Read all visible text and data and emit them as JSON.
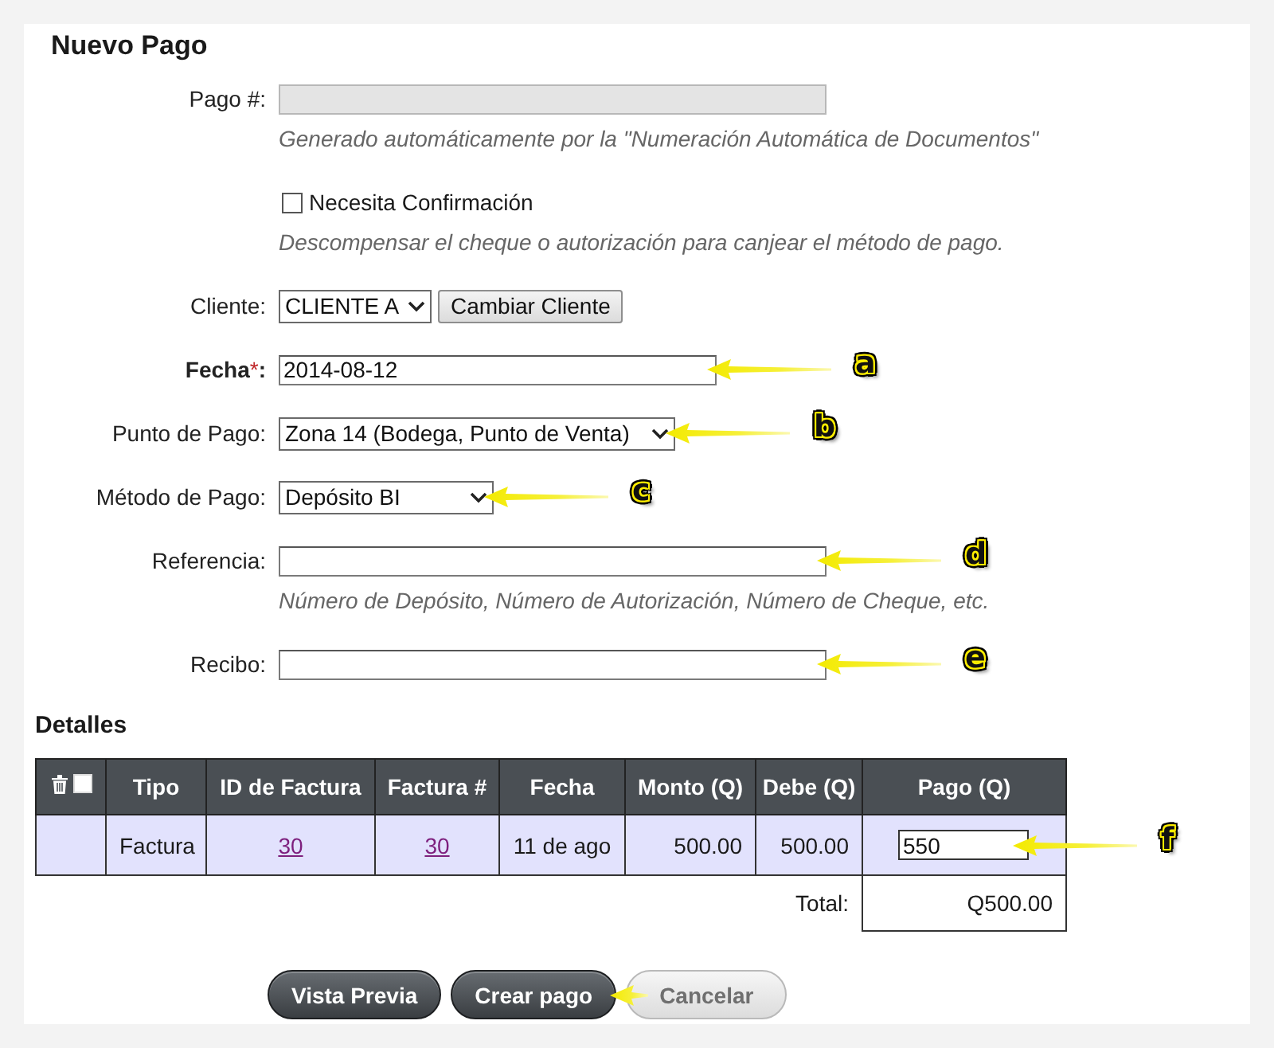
{
  "title": "Nuevo Pago",
  "fields": [
    {
      "kind": "text",
      "label": "Pago #:",
      "disabled": true,
      "hint": "Generado automáticamente por la \"Numeración Automática de Documentos\""
    },
    {
      "kind": "checkbox",
      "text": "Necesita Confirmación",
      "checked": false,
      "hint": "Descompensar el cheque o autorización para canjear el método de pago."
    },
    {
      "kind": "select",
      "label": "Cliente:",
      "value": "CLIENTE A",
      "button": "Cambiar Cliente"
    },
    {
      "kind": "text",
      "label": "Fecha",
      "required_mark": "*",
      "label_end": ":",
      "value": "2014-08-12",
      "disabled": false,
      "callout": "a"
    },
    {
      "kind": "select",
      "label": "Punto de Pago:",
      "value": "Zona 14 (Bodega, Punto de Venta)",
      "callout": "b"
    },
    {
      "kind": "select",
      "label": "Método de Pago:",
      "value": "Depósito BI",
      "callout": "c"
    },
    {
      "kind": "text",
      "label": "Referencia:",
      "disabled": false,
      "hint": "Número de Depósito, Número de Autorización, Número de Cheque, etc.",
      "callout": "d"
    },
    {
      "kind": "text",
      "label": "Recibo:",
      "disabled": false,
      "callout": "e"
    }
  ],
  "details": {
    "title": "Detalles",
    "select_all_checked": false,
    "columns": [
      "Tipo",
      "ID de Factura",
      "Factura #",
      "Fecha",
      "Monto (Q)",
      "Debe (Q)",
      "Pago (Q)"
    ],
    "rows": [
      {
        "cells": [
          {
            "kind": "text",
            "text": "Factura"
          },
          {
            "kind": "link",
            "text": "30"
          },
          {
            "kind": "link",
            "text": "30"
          },
          {
            "kind": "text",
            "text": "11 de ago"
          },
          {
            "kind": "amount",
            "text": "500.00"
          },
          {
            "kind": "amount",
            "text": "500.00"
          },
          {
            "kind": "input",
            "value": "550",
            "callout": "f"
          }
        ]
      }
    ],
    "total": {
      "label": "Total:",
      "value": "Q500.00"
    }
  },
  "buttons": [
    {
      "label": "Vista Previa",
      "kind": "primary",
      "arrow": false
    },
    {
      "label": "Crear pago",
      "kind": "primary",
      "arrow": true
    },
    {
      "label": "Cancelar",
      "kind": "secondary",
      "arrow": false
    }
  ]
}
